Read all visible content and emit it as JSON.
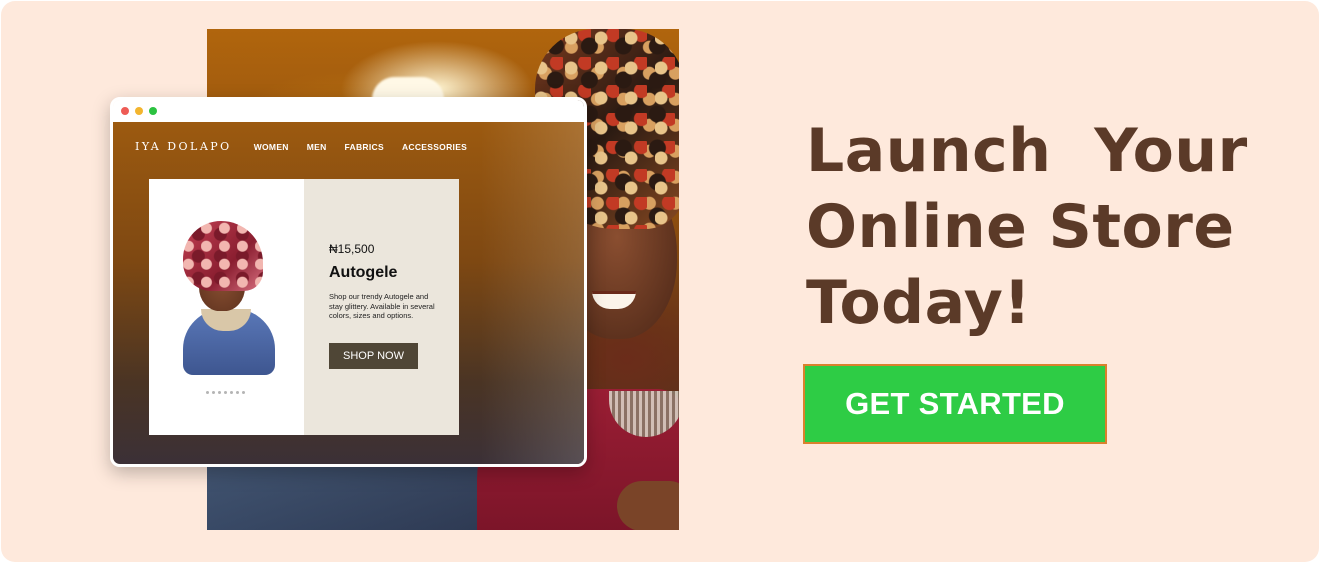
{
  "headline": {
    "line1": "Launch  Your",
    "line2": "Online Store",
    "line3": "Today!"
  },
  "cta": {
    "label": "GET STARTED"
  },
  "mockup": {
    "logo": "IYA DOLAPO",
    "nav": [
      "WOMEN",
      "MEN",
      "FABRICS",
      "ACCESSORIES"
    ],
    "product": {
      "price": "₦15,500",
      "title": "Autogele",
      "description": "Shop our trendy Autogele and stay glittery. Available in several colors, sizes and options.",
      "button": "SHOP NOW"
    },
    "carousel_dots": 7
  },
  "colors": {
    "background": "#fee9dc",
    "headline": "#5b3a28",
    "cta_fill": "#2ecc45",
    "cta_border": "#d9812d",
    "shop_button": "#4f4636"
  }
}
